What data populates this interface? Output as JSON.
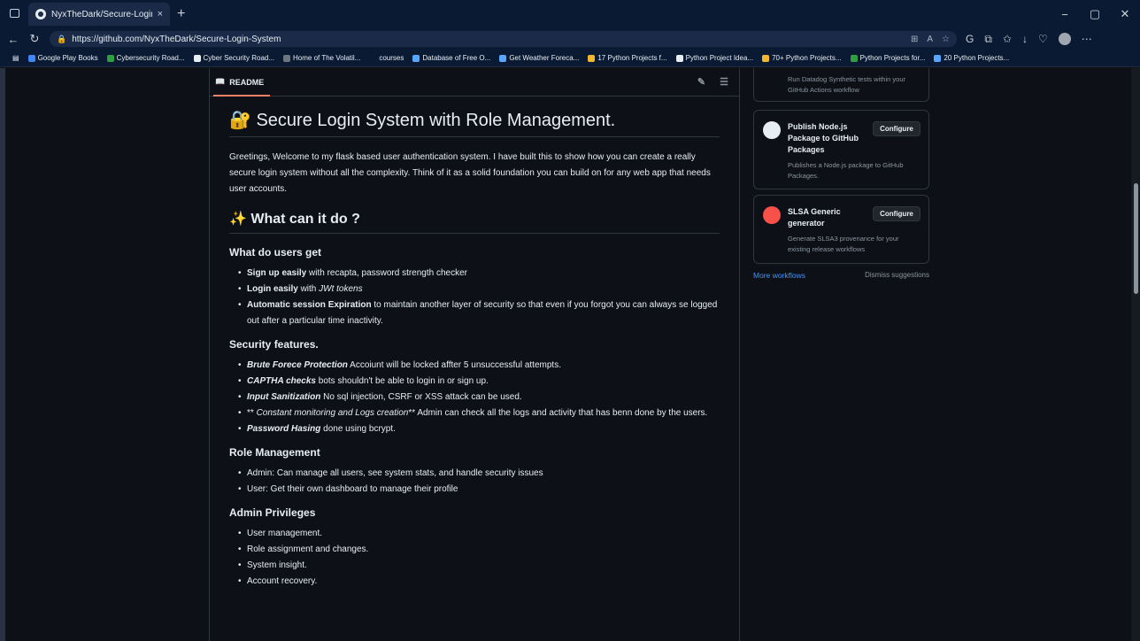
{
  "browser": {
    "tab_title": "NyxTheDark/Secure-Login-System",
    "tab_close": "×",
    "new_tab": "+",
    "url": "https://github.com/NyxTheDark/Secure-Login-System",
    "window_controls": [
      "−",
      "▢",
      "✕"
    ],
    "bookmarks": [
      {
        "label": "Google Play Books",
        "color": "#4285f4"
      },
      {
        "label": "Cybersecurity Road...",
        "color": "#2ea043"
      },
      {
        "label": "Cyber Security Road...",
        "color": "#e6edf3"
      },
      {
        "label": "Home of The Volatil...",
        "color": "#6e7681"
      },
      {
        "label": "courses",
        "color": "#0b1a33"
      },
      {
        "label": "Database of Free O...",
        "color": "#58a6ff"
      },
      {
        "label": "Get Weather Foreca...",
        "color": "#58a6ff"
      },
      {
        "label": "17 Python Projects f...",
        "color": "#f0b72f"
      },
      {
        "label": "Python Project Idea...",
        "color": "#e6edf3"
      },
      {
        "label": "70+ Python Projects...",
        "color": "#f0b72f"
      },
      {
        "label": "Python Projects for...",
        "color": "#2ea043"
      },
      {
        "label": "20 Python Projects...",
        "color": "#58a6ff"
      }
    ]
  },
  "readme": {
    "tab_label": "README",
    "title": "🔐 Secure Login System with Role Management.",
    "intro": "Greetings, Welcome to my flask based user authentication system. I have built this to show how you can create a really secure login system without all the complexity. Think of it as a solid foundation you can build on for any web app that needs user accounts.",
    "section_title": "✨ What can it do ?",
    "users": {
      "heading": "What do users get",
      "items": [
        {
          "bold": "Sign up easily",
          "rest": " with recapta, password strength checker"
        },
        {
          "bold": "Login easily",
          "rest": " with ",
          "italic": "JWt tokens"
        },
        {
          "bold": "Automatic session Expiration",
          "rest": " to maintain another layer of security so that even if you forgot you can always se logged out after a particular time inactivity."
        }
      ]
    },
    "security": {
      "heading": "Security features.",
      "items": [
        {
          "bolditalic": "Brute Forece Protection",
          "rest": " Accoiunt will be locked affter 5 unsuccessful attempts."
        },
        {
          "bolditalic": "CAPTHA checks",
          "rest": " bots shouldn't be able to login in or sign up."
        },
        {
          "bolditalic": "Input Sanitization",
          "rest": " No sql injection, CSRF or XSS attack can be used."
        },
        {
          "prefix": "** ",
          "italic": "Constant monitoring and Logs creation",
          "rest": "** Admin can check all the logs and activity that has benn done by the users."
        },
        {
          "bolditalic": "Password Hasing",
          "rest": " done using bcrypt."
        }
      ]
    },
    "roles": {
      "heading": "Role Management",
      "items": [
        "Admin: Can manage all users, see system stats, and handle security issues",
        "User: Get their own dashboard to manage their profile"
      ]
    },
    "admin": {
      "heading": "Admin Privileges",
      "items": [
        "User management.",
        "Role assignment and changes.",
        "System insight.",
        "Account recovery."
      ]
    }
  },
  "sidebar": {
    "partial_desc": "Run Datadog Synthetic tests within your GitHub Actions workflow",
    "cards": [
      {
        "name": "Publish Node.js Package to GitHub Packages",
        "desc": "Publishes a Node.js package to GitHub Packages.",
        "button": "Configure",
        "logo_color": "#e6edf3"
      },
      {
        "name": "SLSA Generic generator",
        "desc": "Generate SLSA3 provenance for your existing release workflows",
        "button": "Configure",
        "logo_color": "#f85149"
      }
    ],
    "more_workflows": "More workflows",
    "dismiss": "Dismiss suggestions"
  }
}
